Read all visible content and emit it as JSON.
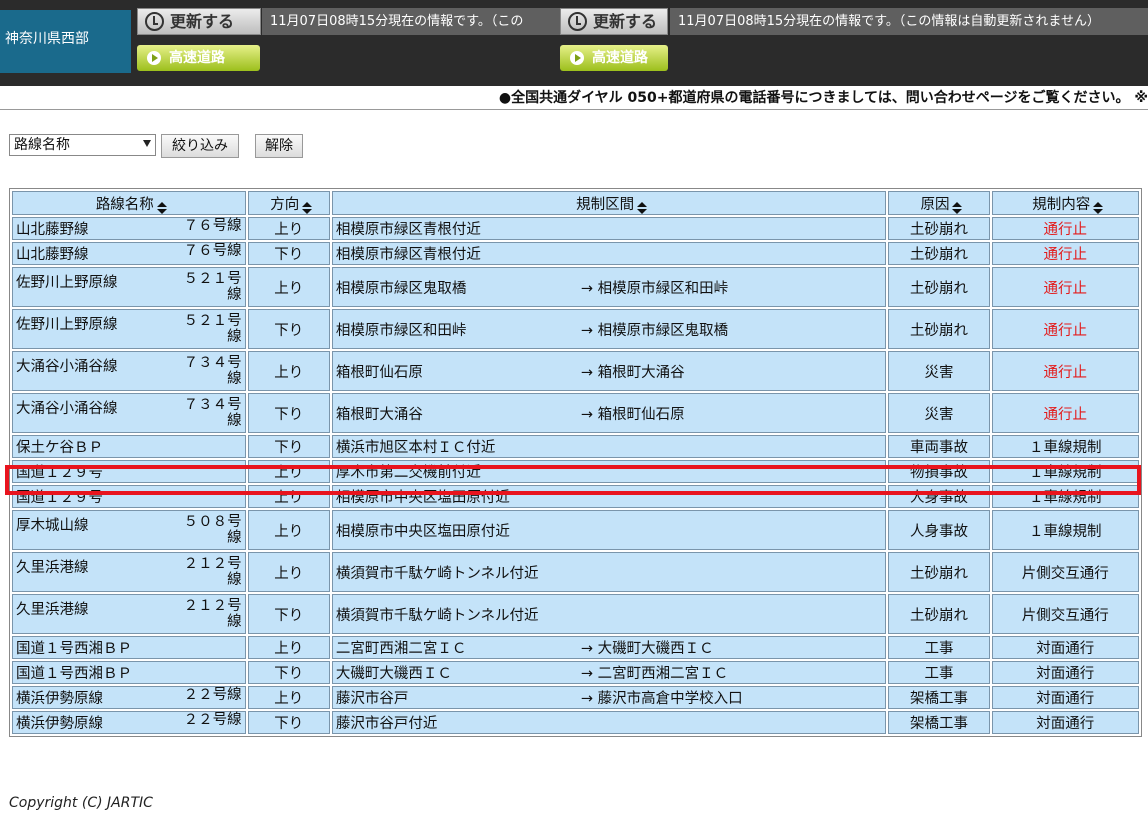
{
  "header": {
    "region": "神奈川県西部",
    "update_label": "更新する",
    "info_text_1": "11月07日08時15分現在の情報です。（この",
    "info_text_2": "11月07日08時15分現在の情報です。（この情報は自動更新されません）",
    "highway_label": "高速道路"
  },
  "notice": "●全国共通ダイヤル 050+都道府県の電話番号につきましては、問い合わせページをご覧ください。 ※",
  "filter": {
    "select_value": "路線名称",
    "narrow_label": "絞り込み",
    "clear_label": "解除"
  },
  "table": {
    "headers": [
      "路線名称",
      "方向",
      "規制区間",
      "原因",
      "規制内容"
    ],
    "rows": [
      {
        "route": "山北藤野線",
        "num": "７６号線",
        "dir": "上り",
        "from": "相模原市緑区青根付近",
        "to": "",
        "cause": "土砂崩れ",
        "content": "通行止"
      },
      {
        "route": "山北藤野線",
        "num": "７６号線",
        "dir": "下り",
        "from": "相模原市緑区青根付近",
        "to": "",
        "cause": "土砂崩れ",
        "content": "通行止"
      },
      {
        "route": "佐野川上野原線",
        "num": "５２１号線",
        "dir": "上り",
        "from": "相模原市緑区鬼取橋",
        "to": "→ 相模原市緑区和田峠",
        "cause": "土砂崩れ",
        "content": "通行止"
      },
      {
        "route": "佐野川上野原線",
        "num": "５２１号線",
        "dir": "下り",
        "from": "相模原市緑区和田峠",
        "to": "→ 相模原市緑区鬼取橋",
        "cause": "土砂崩れ",
        "content": "通行止"
      },
      {
        "route": "大涌谷小涌谷線",
        "num": "７３４号線",
        "dir": "上り",
        "from": "箱根町仙石原",
        "to": "→ 箱根町大涌谷",
        "cause": "災害",
        "content": "通行止"
      },
      {
        "route": "大涌谷小涌谷線",
        "num": "７３４号線",
        "dir": "下り",
        "from": "箱根町大涌谷",
        "to": "→ 箱根町仙石原",
        "cause": "災害",
        "content": "通行止"
      },
      {
        "route": "保土ケ谷ＢＰ",
        "num": "",
        "dir": "下り",
        "from": "横浜市旭区本村ＩＣ付近",
        "to": "",
        "cause": "車両事故",
        "content": "１車線規制"
      },
      {
        "route": "国道１２９号",
        "num": "",
        "dir": "上り",
        "from": "厚木市第二交機前付近",
        "to": "",
        "cause": "物損事故",
        "content": "１車線規制"
      },
      {
        "route": "国道１２９号",
        "num": "",
        "dir": "上り",
        "from": "相模原市中央区塩田原付近",
        "to": "",
        "cause": "人身事故",
        "content": "１車線規制"
      },
      {
        "route": "厚木城山線",
        "num": "５０８号線",
        "dir": "上り",
        "from": "相模原市中央区塩田原付近",
        "to": "",
        "cause": "人身事故",
        "content": "１車線規制"
      },
      {
        "route": "久里浜港線",
        "num": "２１２号線",
        "dir": "上り",
        "from": "横須賀市千駄ケ崎トンネル付近",
        "to": "",
        "cause": "土砂崩れ",
        "content": "片側交互通行"
      },
      {
        "route": "久里浜港線",
        "num": "２１２号線",
        "dir": "下り",
        "from": "横須賀市千駄ケ崎トンネル付近",
        "to": "",
        "cause": "土砂崩れ",
        "content": "片側交互通行"
      },
      {
        "route": "国道１号西湘ＢＰ",
        "num": "",
        "dir": "上り",
        "from": "二宮町西湘二宮ＩＣ",
        "to": "→ 大磯町大磯西ＩＣ",
        "cause": "工事",
        "content": "対面通行"
      },
      {
        "route": "国道１号西湘ＢＰ",
        "num": "",
        "dir": "下り",
        "from": "大磯町大磯西ＩＣ",
        "to": "→ 二宮町西湘二宮ＩＣ",
        "cause": "工事",
        "content": "対面通行"
      },
      {
        "route": "横浜伊勢原線",
        "num": "２２号線",
        "dir": "上り",
        "from": "藤沢市谷戸",
        "to": "→ 藤沢市高倉中学校入口",
        "cause": "架橋工事",
        "content": "対面通行"
      },
      {
        "route": "横浜伊勢原線",
        "num": "２２号線",
        "dir": "下り",
        "from": "藤沢市谷戸付近",
        "to": "",
        "cause": "架橋工事",
        "content": "対面通行"
      }
    ]
  },
  "colors": {
    "closed": "#e31a1a",
    "highlight": "#e8141e",
    "cell_bg": "#c4e3f9"
  },
  "footer": {
    "copyright": "Copyright (C) JARTIC"
  }
}
